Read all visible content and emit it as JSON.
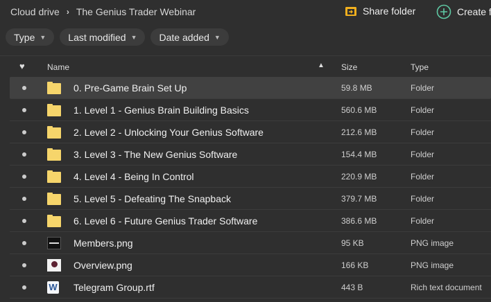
{
  "breadcrumb": {
    "root": "Cloud drive",
    "current": "The Genius Trader Webinar"
  },
  "actions": {
    "share": "Share folder",
    "create": "Create f"
  },
  "filters": [
    "Type",
    "Last modified",
    "Date added"
  ],
  "columns": {
    "name": "Name",
    "size": "Size",
    "type": "Type"
  },
  "rows": [
    {
      "name": "0. Pre-Game Brain Set Up",
      "size": "59.8 MB",
      "type": "Folder",
      "icon": "folder"
    },
    {
      "name": "1. Level 1 - Genius Brain Building Basics",
      "size": "560.6 MB",
      "type": "Folder",
      "icon": "folder"
    },
    {
      "name": "2. Level 2 - Unlocking Your Genius Software",
      "size": "212.6 MB",
      "type": "Folder",
      "icon": "folder"
    },
    {
      "name": "3. Level 3 - The New Genius Software",
      "size": "154.4 MB",
      "type": "Folder",
      "icon": "folder"
    },
    {
      "name": "4. Level 4 - Being In Control",
      "size": "220.9 MB",
      "type": "Folder",
      "icon": "folder"
    },
    {
      "name": "5. Level 5 - Defeating The Snapback",
      "size": "379.7 MB",
      "type": "Folder",
      "icon": "folder"
    },
    {
      "name": "6. Level 6 - Future Genius Trader Software",
      "size": "386.6 MB",
      "type": "Folder",
      "icon": "folder"
    },
    {
      "name": "Members.png",
      "size": "95 KB",
      "type": "PNG image",
      "icon": "image-dark"
    },
    {
      "name": "Overview.png",
      "size": "166 KB",
      "type": "PNG image",
      "icon": "image-light"
    },
    {
      "name": "Telegram Group.rtf",
      "size": "443 B",
      "type": "Rich text document",
      "icon": "word"
    }
  ],
  "colors": {
    "folder": "#f6d56b",
    "share": "#f2b01e",
    "create": "#5fc9a4"
  }
}
